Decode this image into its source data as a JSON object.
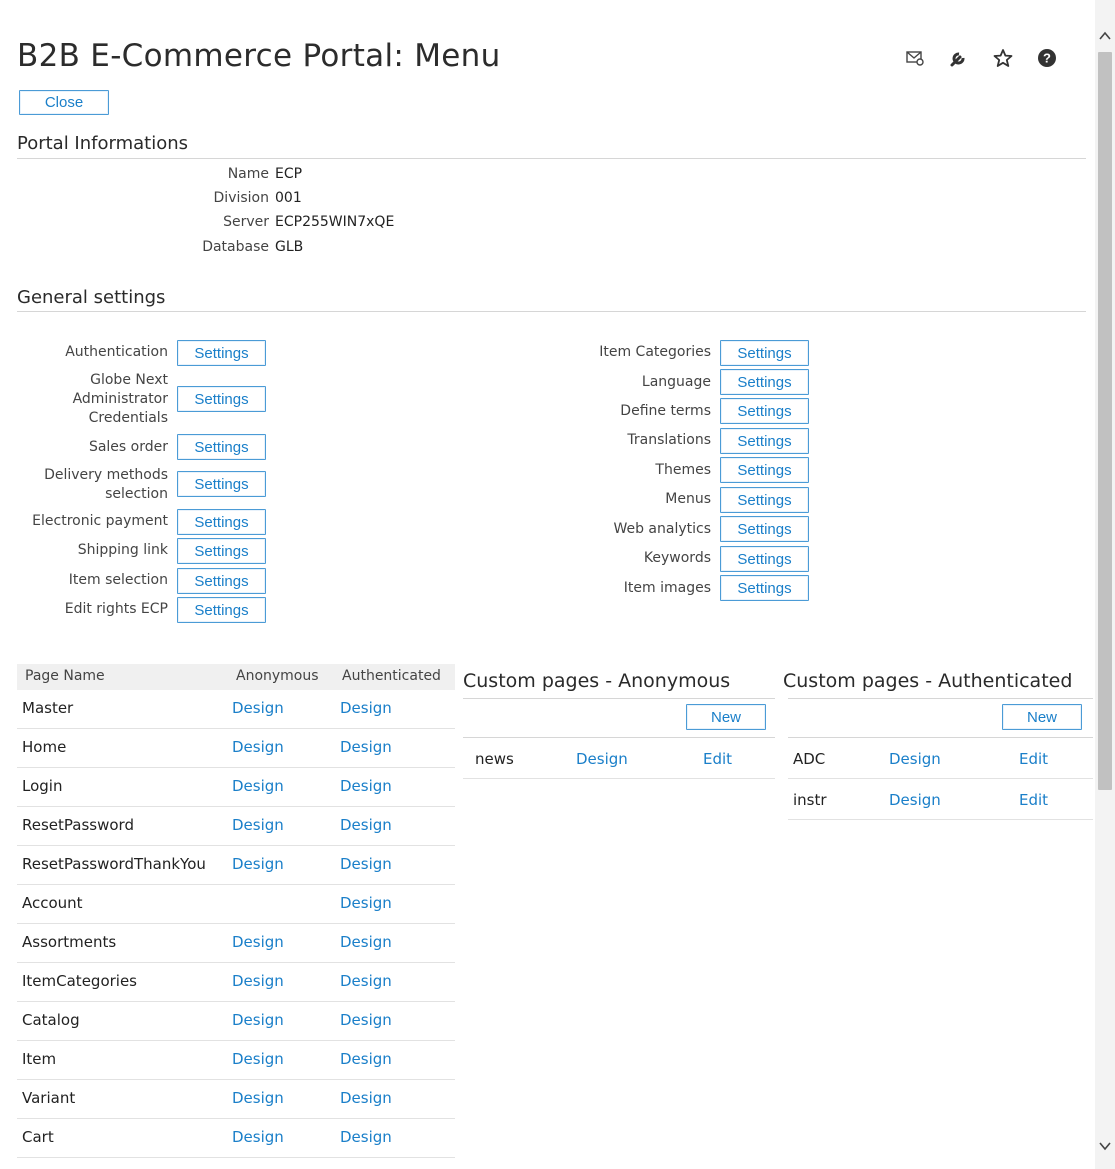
{
  "title": "B2B E-Commerce Portal: Menu",
  "close_label": "Close",
  "portal_info": {
    "title": "Portal Informations",
    "rows": [
      {
        "label": "Name",
        "value": "ECP"
      },
      {
        "label": "Division",
        "value": "001"
      },
      {
        "label": "Server",
        "value": "ECP255WIN7xQE"
      },
      {
        "label": "Database",
        "value": "GLB"
      }
    ]
  },
  "general": {
    "title": "General settings",
    "button_label": "Settings",
    "left": [
      "Authentication",
      "Globe Next Administrator Credentials",
      "Sales order",
      "Delivery methods selection",
      "Electronic payment",
      "Shipping link",
      "Item selection",
      "Edit rights ECP"
    ],
    "right": [
      "Item Categories",
      "Language",
      "Define terms",
      "Translations",
      "Themes",
      "Menus",
      "Web analytics",
      "Keywords",
      "Item images"
    ]
  },
  "pages_table": {
    "headers": [
      "Page Name",
      "Anonymous",
      "Authenticated"
    ],
    "rows": [
      {
        "name": "Master",
        "anon": "Design",
        "auth": "Design"
      },
      {
        "name": "Home",
        "anon": "Design",
        "auth": "Design"
      },
      {
        "name": "Login",
        "anon": "Design",
        "auth": "Design"
      },
      {
        "name": "ResetPassword",
        "anon": "Design",
        "auth": "Design"
      },
      {
        "name": "ResetPasswordThankYou",
        "anon": "Design",
        "auth": "Design"
      },
      {
        "name": "Account",
        "anon": "",
        "auth": "Design"
      },
      {
        "name": "Assortments",
        "anon": "Design",
        "auth": "Design"
      },
      {
        "name": "ItemCategories",
        "anon": "Design",
        "auth": "Design"
      },
      {
        "name": "Catalog",
        "anon": "Design",
        "auth": "Design"
      },
      {
        "name": "Item",
        "anon": "Design",
        "auth": "Design"
      },
      {
        "name": "Variant",
        "anon": "Design",
        "auth": "Design"
      },
      {
        "name": "Cart",
        "anon": "Design",
        "auth": "Design"
      }
    ]
  },
  "custom_anon": {
    "title": "Custom pages - Anonymous",
    "new_label": "New",
    "rows": [
      {
        "name": "news",
        "design": "Design",
        "edit": "Edit"
      }
    ]
  },
  "custom_auth": {
    "title": "Custom pages - Authenticated",
    "new_label": "New",
    "rows": [
      {
        "name": "ADC",
        "design": "Design",
        "edit": "Edit"
      },
      {
        "name": "instr",
        "design": "Design",
        "edit": "Edit"
      }
    ]
  },
  "icons": [
    "mail-settings-icon",
    "wrench-icon",
    "star-icon",
    "help-icon"
  ],
  "colors": {
    "link": "#1a7fc9",
    "button_border": "#4b9bd6"
  }
}
